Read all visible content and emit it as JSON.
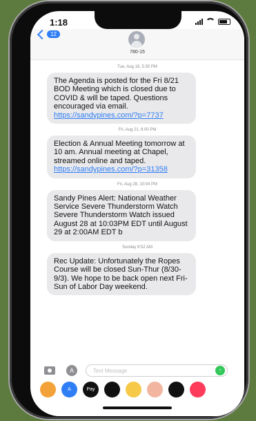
{
  "status": {
    "time": "1:18"
  },
  "header": {
    "back_badge": "12",
    "contact": "780-15"
  },
  "messages": [
    {
      "timestamp": "Tue, Aug 18, 5:30 PM",
      "text": "The Agenda is posted for the Fri 8/21 BOD Meeting which is closed due to COVID & will be taped. Questions encouraged via email.",
      "link": "https://sandypines.com/?p=7737"
    },
    {
      "timestamp": "Fri, Aug 21, 6:00 PM",
      "text": "Election & Annual Meeting tomorrow at 10 am. Annual meeting at Chapel, streamed online and taped.",
      "link": "https://sandypines.com/?p=31358"
    },
    {
      "timestamp": "Fri, Aug 28, 10:04 PM",
      "text": "Sandy Pines Alert: National Weather Service Severe Thunderstorm Watch Severe Thunderstorm Watch issued August 28 at 10:03PM EDT until August 29 at 2:00AM EDT b",
      "link": ""
    },
    {
      "timestamp": "Sunday 9:52 AM",
      "text": "Rec Update: Unfortunately the Ropes Course will be closed Sun-Thur (8/30-9/3). We hope to be back open next Fri-Sun of Labor Day weekend.",
      "link": ""
    }
  ],
  "input": {
    "placeholder": "Text Message"
  },
  "dock": [
    {
      "icon": "photos-icon",
      "color": "#f3a23a",
      "label": ""
    },
    {
      "icon": "appstore-icon",
      "color": "#2f7ef6",
      "label": "A"
    },
    {
      "icon": "applepay-icon",
      "color": "#111111",
      "label": "Pay"
    },
    {
      "icon": "activity-icon",
      "color": "#111111",
      "label": ""
    },
    {
      "icon": "animoji-icon",
      "color": "#f7c948",
      "label": ""
    },
    {
      "icon": "memoji-icon",
      "color": "#f2b6a0",
      "label": ""
    },
    {
      "icon": "digitaltouch-icon",
      "color": "#111111",
      "label": ""
    },
    {
      "icon": "music-icon",
      "color": "#ff3b5c",
      "label": ""
    }
  ]
}
